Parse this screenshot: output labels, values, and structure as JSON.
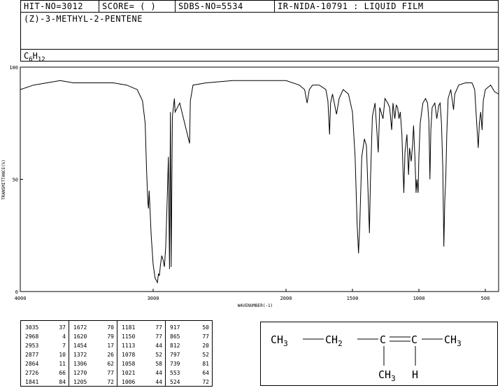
{
  "header": {
    "hit_no": "HIT-NO=3012",
    "score": "SCORE=  (   )",
    "sdbs_no": "SDBS-NO=5534",
    "ir_info": "IR-NIDA-10791 : LIQUID FILM",
    "compound_name": "(Z)-3-METHYL-2-PENTENE",
    "formula_main": "C",
    "formula_sub1": "6",
    "formula_h": "H",
    "formula_sub2": "12"
  },
  "chart_data": {
    "type": "line",
    "xlabel": "WAVENUMBER(-1)",
    "ylabel": "TRANSMITTANCE(%)",
    "xlim": [
      4000,
      400
    ],
    "ylim": [
      0,
      100
    ],
    "x_ticks": [
      4000,
      3000,
      2000,
      1500,
      1000,
      500
    ],
    "y_ticks": [
      0,
      50,
      100
    ],
    "series": [
      {
        "points": [
          [
            4000,
            90
          ],
          [
            3900,
            92
          ],
          [
            3800,
            93
          ],
          [
            3700,
            94
          ],
          [
            3600,
            93
          ],
          [
            3500,
            93
          ],
          [
            3400,
            93
          ],
          [
            3300,
            93
          ],
          [
            3200,
            92
          ],
          [
            3120,
            90
          ],
          [
            3080,
            85
          ],
          [
            3060,
            75
          ],
          [
            3050,
            55
          ],
          [
            3040,
            40
          ],
          [
            3035,
            37
          ],
          [
            3030,
            45
          ],
          [
            3015,
            25
          ],
          [
            3000,
            12
          ],
          [
            2985,
            6
          ],
          [
            2968,
            4
          ],
          [
            2960,
            8
          ],
          [
            2953,
            7
          ],
          [
            2945,
            12
          ],
          [
            2935,
            16
          ],
          [
            2925,
            14
          ],
          [
            2915,
            11
          ],
          [
            2905,
            20
          ],
          [
            2895,
            40
          ],
          [
            2885,
            60
          ],
          [
            2877,
            10
          ],
          [
            2870,
            80
          ],
          [
            2864,
            11
          ],
          [
            2855,
            78
          ],
          [
            2840,
            86
          ],
          [
            2835,
            80
          ],
          [
            2800,
            84
          ],
          [
            2726,
            66
          ],
          [
            2720,
            85
          ],
          [
            2700,
            92
          ],
          [
            2600,
            93
          ],
          [
            2400,
            94
          ],
          [
            2200,
            94
          ],
          [
            2000,
            94
          ],
          [
            1900,
            92
          ],
          [
            1860,
            90
          ],
          [
            1841,
            84
          ],
          [
            1825,
            90
          ],
          [
            1800,
            92
          ],
          [
            1750,
            92
          ],
          [
            1700,
            90
          ],
          [
            1685,
            85
          ],
          [
            1672,
            70
          ],
          [
            1665,
            84
          ],
          [
            1650,
            88
          ],
          [
            1620,
            79
          ],
          [
            1600,
            86
          ],
          [
            1570,
            90
          ],
          [
            1530,
            88
          ],
          [
            1500,
            80
          ],
          [
            1480,
            60
          ],
          [
            1465,
            30
          ],
          [
            1454,
            17
          ],
          [
            1445,
            30
          ],
          [
            1430,
            60
          ],
          [
            1410,
            68
          ],
          [
            1395,
            65
          ],
          [
            1380,
            40
          ],
          [
            1372,
            26
          ],
          [
            1365,
            48
          ],
          [
            1350,
            78
          ],
          [
            1330,
            84
          ],
          [
            1306,
            62
          ],
          [
            1295,
            82
          ],
          [
            1270,
            77
          ],
          [
            1255,
            86
          ],
          [
            1235,
            84
          ],
          [
            1220,
            82
          ],
          [
            1205,
            72
          ],
          [
            1195,
            84
          ],
          [
            1181,
            77
          ],
          [
            1170,
            83
          ],
          [
            1160,
            82
          ],
          [
            1150,
            77
          ],
          [
            1140,
            80
          ],
          [
            1128,
            70
          ],
          [
            1120,
            55
          ],
          [
            1113,
            44
          ],
          [
            1105,
            62
          ],
          [
            1090,
            70
          ],
          [
            1078,
            52
          ],
          [
            1070,
            64
          ],
          [
            1058,
            58
          ],
          [
            1048,
            65
          ],
          [
            1040,
            74
          ],
          [
            1030,
            60
          ],
          [
            1021,
            44
          ],
          [
            1015,
            50
          ],
          [
            1006,
            44
          ],
          [
            1000,
            60
          ],
          [
            990,
            75
          ],
          [
            970,
            84
          ],
          [
            950,
            86
          ],
          [
            935,
            84
          ],
          [
            925,
            76
          ],
          [
            917,
            50
          ],
          [
            910,
            72
          ],
          [
            900,
            82
          ],
          [
            880,
            84
          ],
          [
            865,
            77
          ],
          [
            850,
            83
          ],
          [
            840,
            84
          ],
          [
            830,
            75
          ],
          [
            820,
            55
          ],
          [
            812,
            20
          ],
          [
            805,
            40
          ],
          [
            797,
            52
          ],
          [
            790,
            70
          ],
          [
            780,
            86
          ],
          [
            760,
            90
          ],
          [
            739,
            81
          ],
          [
            730,
            88
          ],
          [
            700,
            92
          ],
          [
            650,
            93
          ],
          [
            600,
            93
          ],
          [
            580,
            90
          ],
          [
            565,
            75
          ],
          [
            553,
            64
          ],
          [
            545,
            75
          ],
          [
            535,
            80
          ],
          [
            524,
            72
          ],
          [
            515,
            85
          ],
          [
            500,
            90
          ],
          [
            460,
            92
          ],
          [
            430,
            89
          ],
          [
            400,
            88
          ]
        ]
      }
    ]
  },
  "peak_table": [
    [
      [
        "3035",
        "37"
      ],
      [
        "2968",
        "4"
      ],
      [
        "2953",
        "7"
      ],
      [
        "2877",
        "10"
      ],
      [
        "2864",
        "11"
      ],
      [
        "2726",
        "66"
      ],
      [
        "1841",
        "84"
      ]
    ],
    [
      [
        "1672",
        "70"
      ],
      [
        "1620",
        "79"
      ],
      [
        "1454",
        "17"
      ],
      [
        "1372",
        "26"
      ],
      [
        "1306",
        "62"
      ],
      [
        "1270",
        "77"
      ],
      [
        "1205",
        "72"
      ]
    ],
    [
      [
        "1181",
        "77"
      ],
      [
        "1150",
        "77"
      ],
      [
        "1113",
        "44"
      ],
      [
        "1078",
        "52"
      ],
      [
        "1058",
        "58"
      ],
      [
        "1021",
        "44"
      ],
      [
        "1006",
        "44"
      ]
    ],
    [
      [
        "917",
        "50"
      ],
      [
        "865",
        "77"
      ],
      [
        "812",
        "20"
      ],
      [
        "797",
        "52"
      ],
      [
        "739",
        "81"
      ],
      [
        "553",
        "64"
      ],
      [
        "524",
        "72"
      ]
    ]
  ],
  "structure": {
    "g1": "CH",
    "g1_sub": "3",
    "g2": "CH",
    "g2_sub": "2",
    "c1": "C",
    "c2": "C",
    "g3": "CH",
    "g3_sub": "3",
    "g4": "CH",
    "g4_sub": "3",
    "h": "H"
  }
}
